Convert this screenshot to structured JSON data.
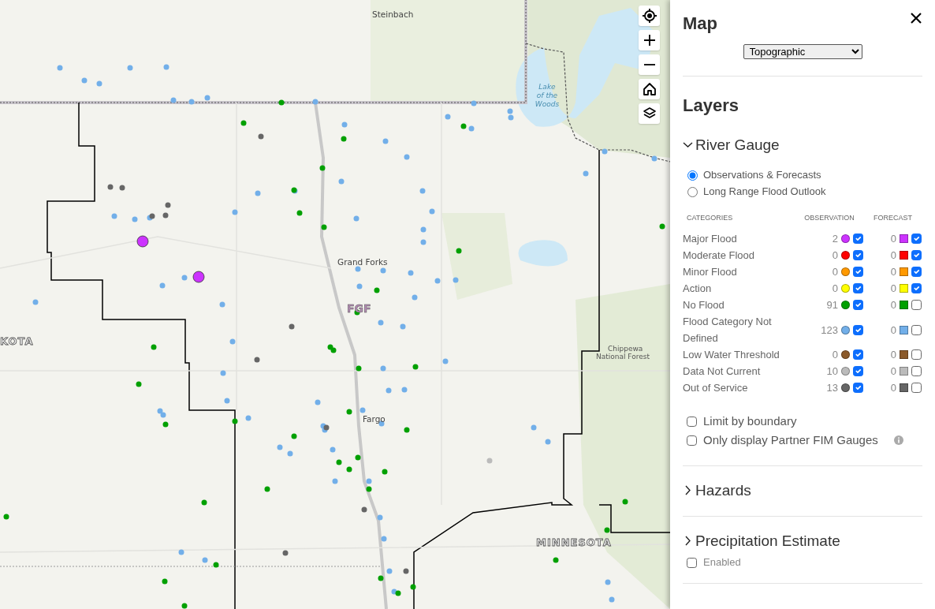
{
  "map": {
    "labels": [
      {
        "kind": "city",
        "text": "Steinbach"
      },
      {
        "kind": "water",
        "text": "Lake of the Woods"
      },
      {
        "kind": "city",
        "text": "Grand Forks"
      },
      {
        "kind": "office",
        "text": "FGF"
      },
      {
        "kind": "city",
        "text": "Fargo"
      },
      {
        "kind": "state",
        "text": "KOTA"
      },
      {
        "kind": "park",
        "text": "Chippewa National Forest"
      },
      {
        "kind": "state",
        "text": "MINNESOTA"
      }
    ],
    "controls": [
      {
        "kind": "locate"
      },
      {
        "kind": "zoom_in"
      },
      {
        "kind": "zoom_out"
      },
      {
        "kind": "home"
      },
      {
        "kind": "layers"
      }
    ]
  },
  "panel": {
    "title": "Map",
    "basemap": {
      "value": "Topographic"
    },
    "layers_title": "Layers",
    "river_gauge": {
      "title": "River Gauge",
      "expanded": true,
      "modes": [
        {
          "label": "Observations & Forecasts",
          "selected": true
        },
        {
          "label": "Long Range Flood Outlook",
          "selected": false
        }
      ],
      "columns": [
        "CATEGORIES",
        "OBSERVATION",
        "FORECAST"
      ],
      "categories": [
        {
          "name": "Major Flood",
          "color": "#cc33ff",
          "observation": {
            "count": "2",
            "checked": true
          },
          "forecast": {
            "count": "0",
            "checked": true
          }
        },
        {
          "name": "Moderate Flood",
          "color": "#ff0000",
          "observation": {
            "count": "0",
            "checked": true
          },
          "forecast": {
            "count": "0",
            "checked": true
          }
        },
        {
          "name": "Minor Flood",
          "color": "#ff9900",
          "observation": {
            "count": "0",
            "checked": true
          },
          "forecast": {
            "count": "0",
            "checked": true
          }
        },
        {
          "name": "Action",
          "color": "#ffff00",
          "observation": {
            "count": "0",
            "checked": true
          },
          "forecast": {
            "count": "0",
            "checked": true
          }
        },
        {
          "name": "No Flood",
          "color": "#00a000",
          "observation": {
            "count": "91",
            "checked": true
          },
          "forecast": {
            "count": "0",
            "checked": false
          }
        },
        {
          "name": "Flood Category Not Defined",
          "color": "#72afe9",
          "observation": {
            "count": "123",
            "checked": true
          },
          "forecast": {
            "count": "0",
            "checked": false
          }
        },
        {
          "name": "Low Water Threshold",
          "color": "#8b5a2b",
          "observation": {
            "count": "0",
            "checked": true
          },
          "forecast": {
            "count": "0",
            "checked": false
          }
        },
        {
          "name": "Data Not Current",
          "color": "#bbbbbb",
          "observation": {
            "count": "10",
            "checked": true
          },
          "forecast": {
            "count": "0",
            "checked": false
          }
        },
        {
          "name": "Out of Service",
          "color": "#666666",
          "observation": {
            "count": "13",
            "checked": true
          },
          "forecast": {
            "count": "0",
            "checked": false
          }
        }
      ],
      "options": [
        {
          "label": "Limit by boundary",
          "checked": false,
          "info": false
        },
        {
          "label": "Only display Partner FIM Gauges",
          "checked": false,
          "info": true
        }
      ]
    },
    "sections": [
      {
        "title": "Hazards",
        "expanded": false
      },
      {
        "title": "Precipitation Estimate",
        "expanded": false,
        "toggle": {
          "label": "Enabled",
          "checked": false
        }
      }
    ]
  }
}
